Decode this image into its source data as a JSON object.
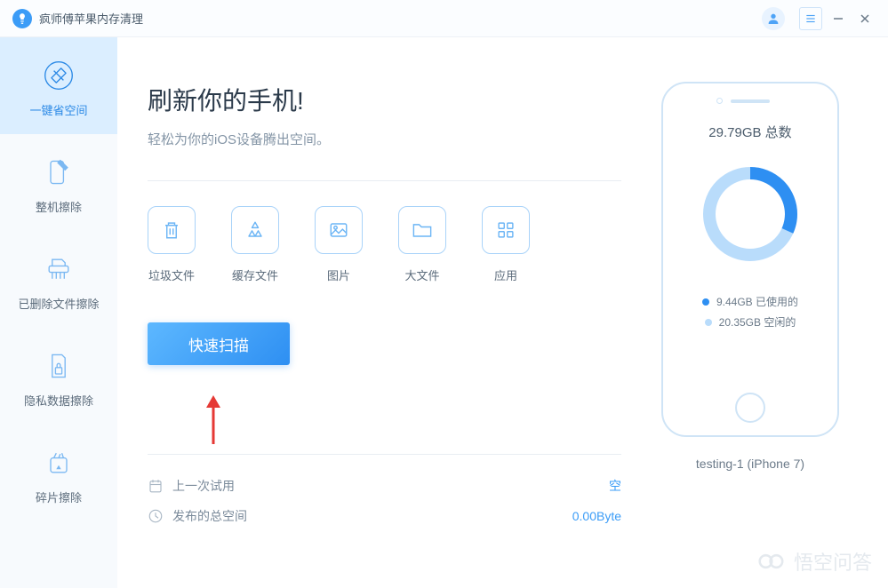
{
  "titlebar": {
    "title": "疯师傅苹果内存清理"
  },
  "sidebar": {
    "items": [
      {
        "label": "一键省空间"
      },
      {
        "label": "整机擦除"
      },
      {
        "label": "已删除文件擦除"
      },
      {
        "label": "隐私数据擦除"
      },
      {
        "label": "碎片擦除"
      }
    ]
  },
  "main": {
    "title": "刷新你的手机!",
    "subtitle": "轻松为你的iOS设备腾出空间。",
    "categories": [
      {
        "label": "垃圾文件"
      },
      {
        "label": "缓存文件"
      },
      {
        "label": "图片"
      },
      {
        "label": "大文件"
      },
      {
        "label": "应用"
      }
    ],
    "scan_button": "快速扫描",
    "info": {
      "last_trial_label": "上一次试用",
      "last_trial_value": "空",
      "released_label": "发布的总空间",
      "released_value": "0.00Byte"
    }
  },
  "device": {
    "total_label": "29.79GB 总数",
    "used_label": "9.44GB 已使用的",
    "free_label": "20.35GB 空闲的",
    "name": "testing-1 (iPhone 7)",
    "used_gb": 9.44,
    "free_gb": 20.35,
    "total_gb": 29.79
  },
  "watermark": "悟空问答",
  "chart_data": {
    "type": "pie",
    "title": "29.79GB 总数",
    "series": [
      {
        "name": "已使用的",
        "value": 9.44,
        "color": "#2e8ff2"
      },
      {
        "name": "空闲的",
        "value": 20.35,
        "color": "#b9dcfb"
      }
    ],
    "unit": "GB"
  }
}
